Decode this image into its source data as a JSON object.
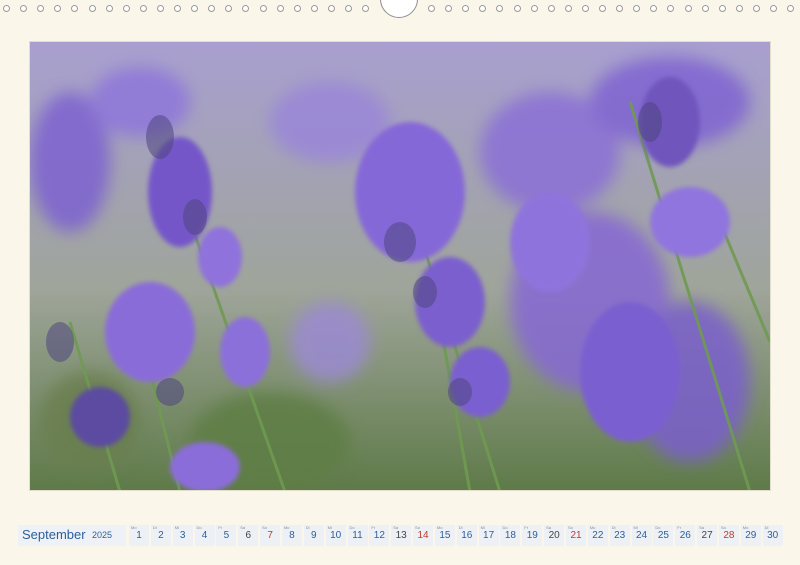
{
  "calendar": {
    "month": "September",
    "year": "2025",
    "days": [
      {
        "d": "1",
        "wd": "Mo",
        "type": "weekday"
      },
      {
        "d": "2",
        "wd": "Di",
        "type": "weekday"
      },
      {
        "d": "3",
        "wd": "Mi",
        "type": "weekday"
      },
      {
        "d": "4",
        "wd": "Do",
        "type": "weekday"
      },
      {
        "d": "5",
        "wd": "Fr",
        "type": "weekday"
      },
      {
        "d": "6",
        "wd": "Sa",
        "type": "sat"
      },
      {
        "d": "7",
        "wd": "So",
        "type": "sun"
      },
      {
        "d": "8",
        "wd": "Mo",
        "type": "weekday"
      },
      {
        "d": "9",
        "wd": "Di",
        "type": "weekday"
      },
      {
        "d": "10",
        "wd": "Mi",
        "type": "weekday"
      },
      {
        "d": "11",
        "wd": "Do",
        "type": "weekday"
      },
      {
        "d": "12",
        "wd": "Fr",
        "type": "weekday"
      },
      {
        "d": "13",
        "wd": "Sa",
        "type": "sat"
      },
      {
        "d": "14",
        "wd": "So",
        "type": "sun"
      },
      {
        "d": "15",
        "wd": "Mo",
        "type": "weekday"
      },
      {
        "d": "16",
        "wd": "Di",
        "type": "weekday"
      },
      {
        "d": "17",
        "wd": "Mi",
        "type": "weekday"
      },
      {
        "d": "18",
        "wd": "Do",
        "type": "weekday"
      },
      {
        "d": "19",
        "wd": "Fr",
        "type": "weekday"
      },
      {
        "d": "20",
        "wd": "Sa",
        "type": "sat"
      },
      {
        "d": "21",
        "wd": "So",
        "type": "sun"
      },
      {
        "d": "22",
        "wd": "Mo",
        "type": "weekday"
      },
      {
        "d": "23",
        "wd": "Di",
        "type": "weekday"
      },
      {
        "d": "24",
        "wd": "Mi",
        "type": "weekday"
      },
      {
        "d": "25",
        "wd": "Do",
        "type": "weekday"
      },
      {
        "d": "26",
        "wd": "Fr",
        "type": "weekday"
      },
      {
        "d": "27",
        "wd": "Sa",
        "type": "sat"
      },
      {
        "d": "28",
        "wd": "So",
        "type": "sun"
      },
      {
        "d": "29",
        "wd": "Mo",
        "type": "weekday"
      },
      {
        "d": "30",
        "wd": "Di",
        "type": "weekday"
      }
    ]
  },
  "photo": {
    "subject": "lavender-flowers",
    "colors": {
      "blossom": "#8a6fd6",
      "blossom_dark": "#5b4a9e",
      "stem": "#6f9a52",
      "background": "#b8b4c9"
    }
  },
  "colors": {
    "page": "#fbf6ea",
    "accent": "#2d5e9a",
    "sunday": "#c0392b"
  }
}
